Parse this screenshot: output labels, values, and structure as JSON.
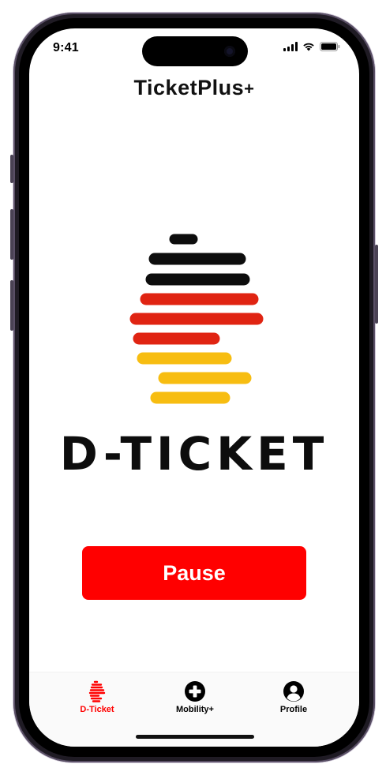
{
  "status_bar": {
    "time": "9:41"
  },
  "app": {
    "title_main": "TicketPlus",
    "title_plus": "+"
  },
  "hero": {
    "wordmark": "D-TICKET"
  },
  "actions": {
    "pause_label": "Pause"
  },
  "tabs": [
    {
      "label": "D-Ticket",
      "icon": "d-ticket-icon",
      "active": true
    },
    {
      "label": "Mobility+",
      "icon": "plus-circle-icon",
      "active": false
    },
    {
      "label": "Profile",
      "icon": "person-circle-icon",
      "active": false
    }
  ],
  "colors": {
    "accent": "#ff0000",
    "flag_black": "#0d0d0d",
    "flag_red": "#e02412",
    "flag_gold": "#f7bd11"
  }
}
